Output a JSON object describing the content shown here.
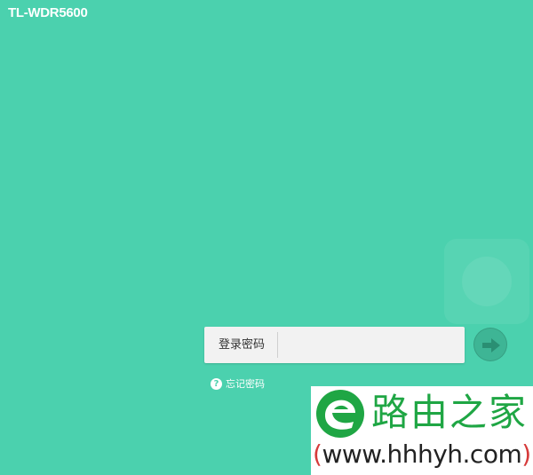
{
  "header": {
    "model": "TL-WDR5600"
  },
  "login": {
    "label": "登录密码",
    "password_value": "",
    "forgot_label": "忘记密码",
    "help_icon": "question-circle-icon",
    "submit_icon": "arrow-right-icon"
  },
  "watermark": {
    "title": "路由之家",
    "url_open": "(",
    "url": "www.hhhyh.com",
    "url_close": ")",
    "logo_icon": "e-leaf-logo"
  },
  "colors": {
    "background": "#4bd1ae",
    "submit": "#3eb595",
    "watermark_green": "#1fa644",
    "watermark_red": "#d63a3a"
  }
}
